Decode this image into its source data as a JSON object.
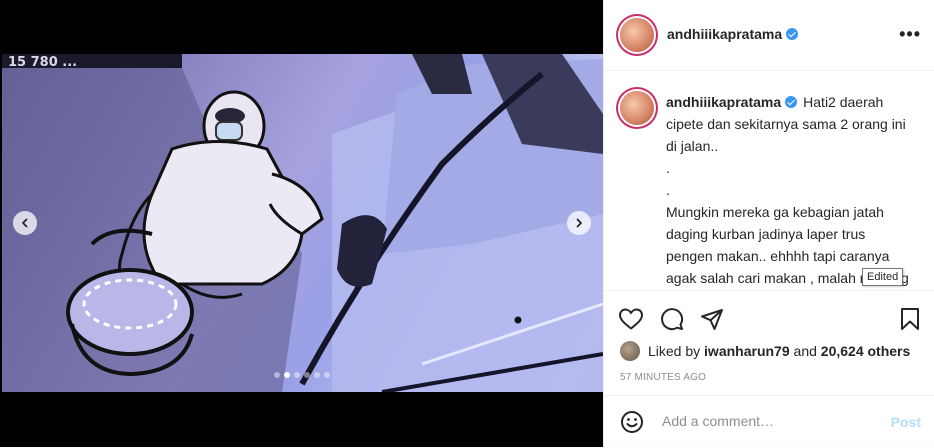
{
  "header": {
    "username": "andhiiikapratama",
    "verified_icon": "verified-badge-icon",
    "more_icon": "more-options-icon"
  },
  "media": {
    "overlay_text": "15 780 ...",
    "carousel": {
      "count": 6,
      "active_index": 1
    }
  },
  "caption": {
    "username": "andhiiikapratama",
    "text": "Hati2 daerah cipete dan sekitarnya sama 2 orang ini di jalan..\n.\n.\nMungkin mereka ga kebagian jatah daging kurban jadinya laper trus pengen makan.. ehhhh tapi caranya agak salah cari makan , malah nyolong spion orang persis depan rumah dikala orang rumah lagi kumpul",
    "edited_tooltip": "Edited"
  },
  "actions": {
    "like_icon": "heart-icon",
    "comment_icon": "comment-icon",
    "share_icon": "share-icon",
    "save_icon": "bookmark-icon"
  },
  "likes": {
    "prefix": "Liked by",
    "first_user": "iwanharun79",
    "joiner": "and",
    "others": "20,624 others"
  },
  "timestamp": "57 MINUTES AGO",
  "comment": {
    "emoji_icon": "emoji-icon",
    "placeholder": "Add a comment…",
    "post_label": "Post"
  },
  "colors": {
    "verified": "#3897f0",
    "post_disabled": "#b2dffc",
    "muted": "#8e8e8e"
  }
}
